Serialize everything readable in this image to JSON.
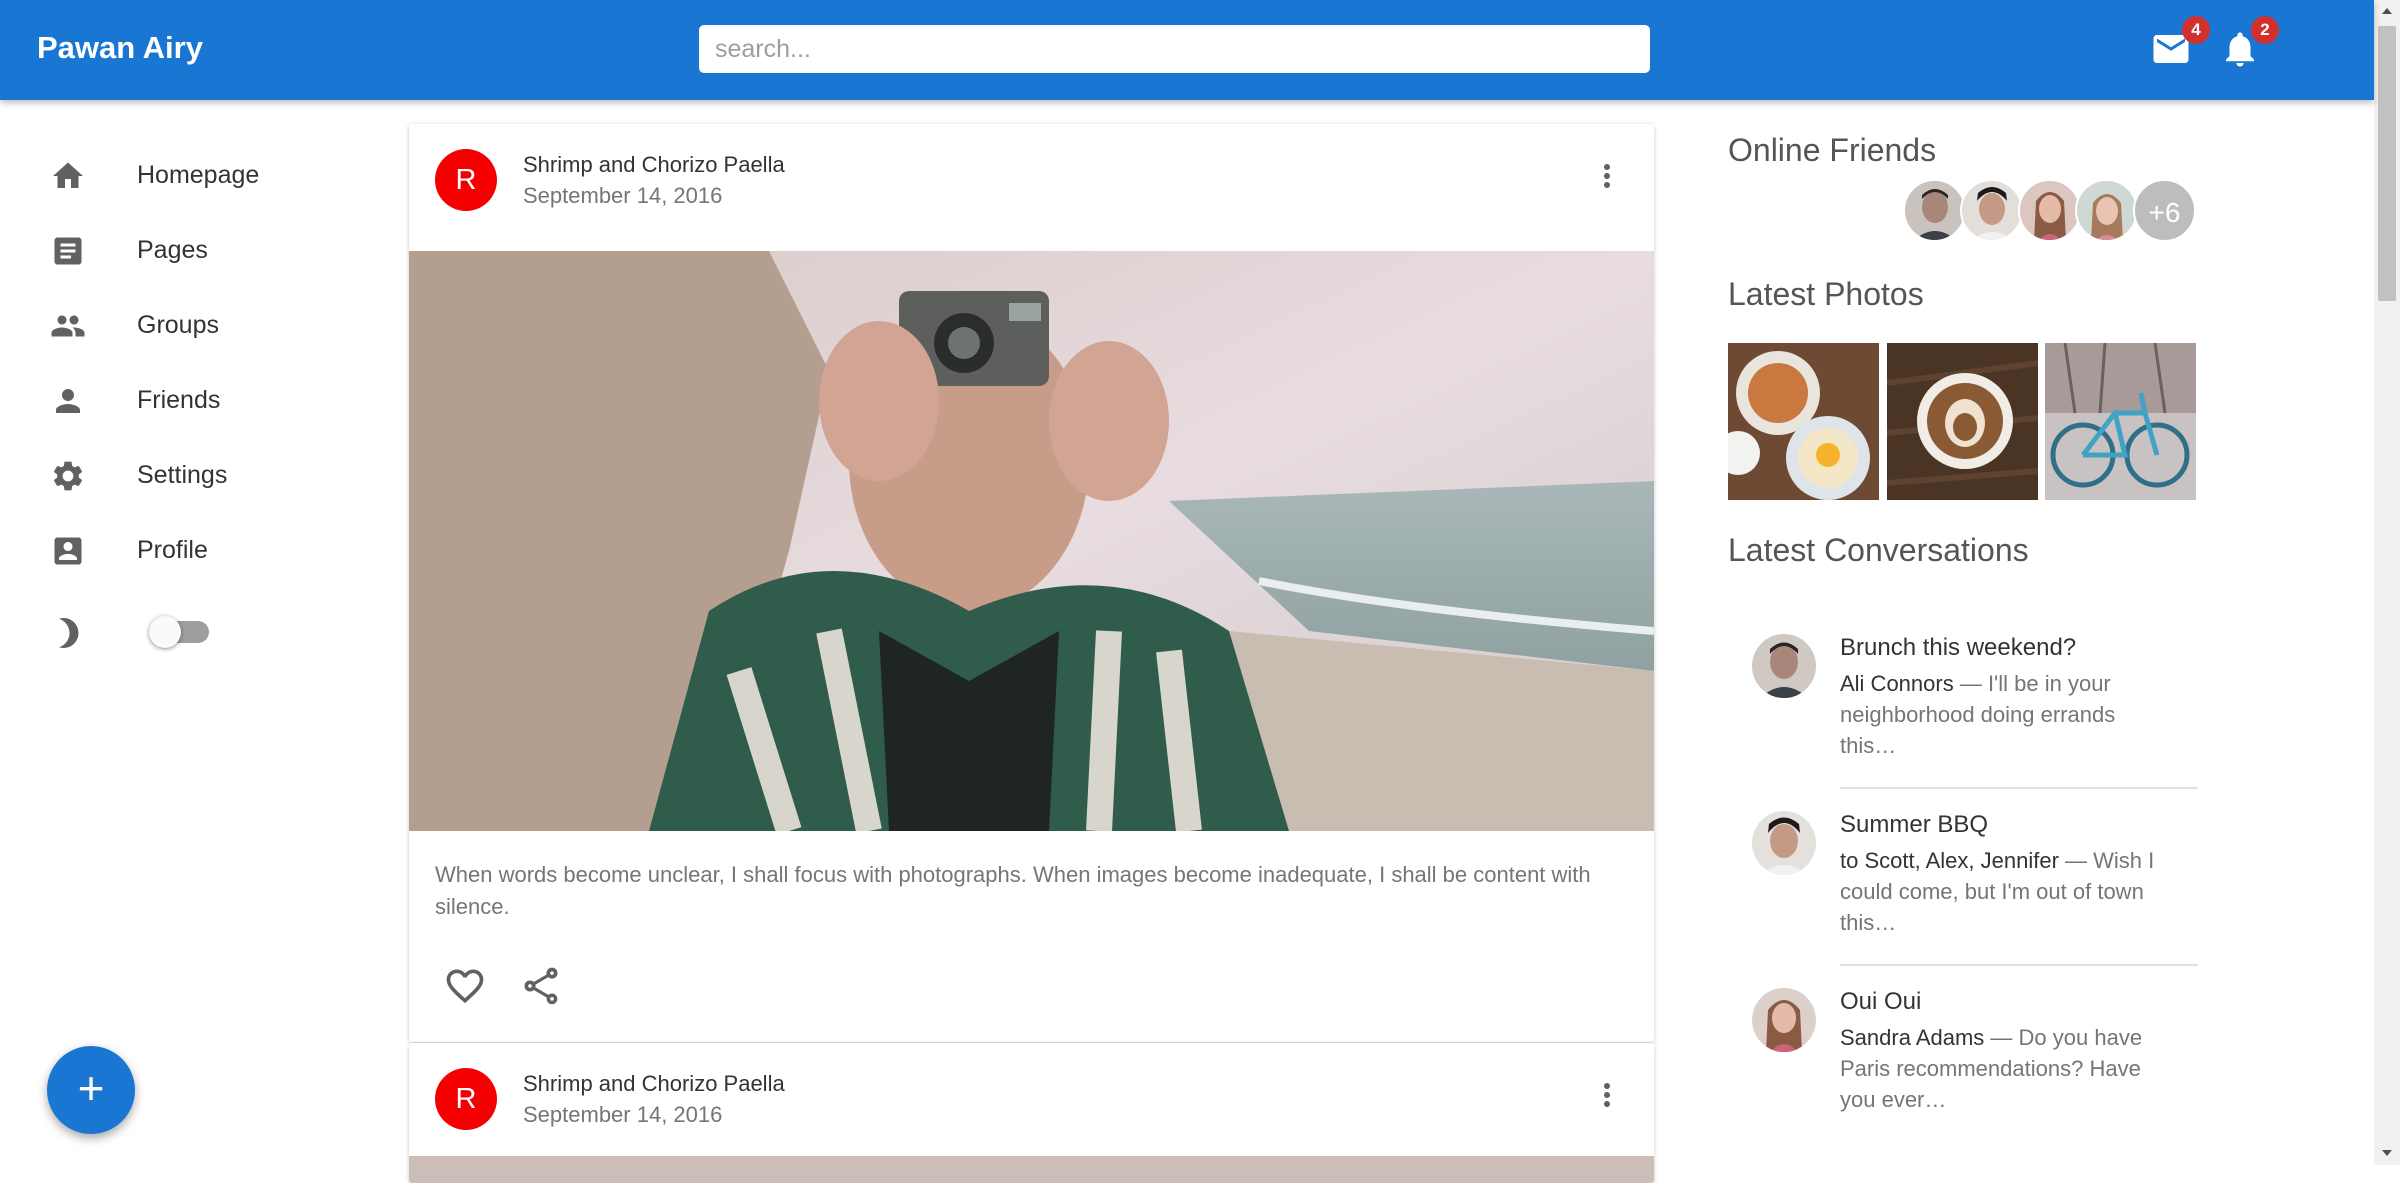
{
  "header": {
    "brand": "Pawan Airy",
    "search_placeholder": "search...",
    "mail_badge": "4",
    "notification_badge": "2"
  },
  "sidebar": {
    "items": [
      {
        "label": "Homepage",
        "icon": "home-icon"
      },
      {
        "label": "Pages",
        "icon": "article-icon"
      },
      {
        "label": "Groups",
        "icon": "groups-icon"
      },
      {
        "label": "Friends",
        "icon": "person-icon"
      },
      {
        "label": "Settings",
        "icon": "gear-icon"
      },
      {
        "label": "Profile",
        "icon": "account-box-icon"
      }
    ],
    "theme_icon": "moon-icon",
    "fab_label": "+"
  },
  "posts": [
    {
      "avatar_letter": "R",
      "title": "Shrimp and Chorizo Paella",
      "date": "September 14, 2016",
      "body": "When words become unclear, I shall focus with photographs. When images become inadequate, I shall be content with silence."
    },
    {
      "avatar_letter": "R",
      "title": "Shrimp and Chorizo Paella",
      "date": "September 14, 2016"
    }
  ],
  "right": {
    "online_friends_title": "Online Friends",
    "online_more": "+6",
    "latest_photos_title": "Latest Photos",
    "latest_conversations_title": "Latest Conversations",
    "conversations": [
      {
        "title": "Brunch this weekend?",
        "who": "Ali Connors",
        "text": " — I'll be in your neighborhood doing errands this…"
      },
      {
        "title": "Summer BBQ",
        "who": "to Scott, Alex, Jennifer",
        "text": " — Wish I could come, but I'm out of town this…"
      },
      {
        "title": "Oui Oui",
        "who": "Sandra Adams",
        "text": " — Do you have Paris recommendations? Have you ever…"
      }
    ]
  },
  "colors": {
    "primary": "#1976d2",
    "avatar_red": "#f40000",
    "badge_red": "#d32f2f"
  }
}
